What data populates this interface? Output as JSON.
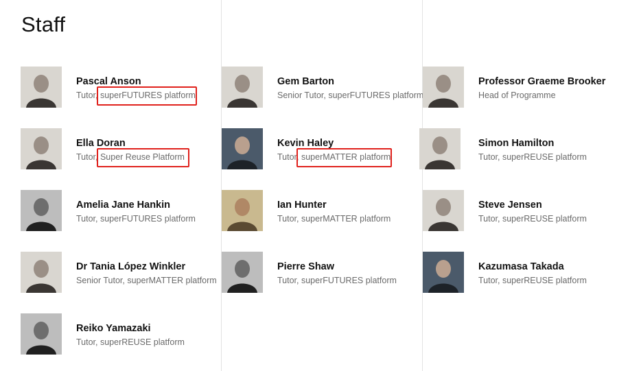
{
  "page": {
    "title": "Staff"
  },
  "staff": [
    {
      "name": "Pascal Anson",
      "role": "Tutor, superFUTURES platform",
      "photo_style": "light"
    },
    {
      "name": "Gem Barton",
      "role": "Senior Tutor, superFUTURES platform",
      "photo_style": "light"
    },
    {
      "name": "Professor Graeme Brooker",
      "role": "Head of Programme",
      "photo_style": "light"
    },
    {
      "name": "Ella Doran",
      "role": "Tutor, Super Reuse Platform",
      "photo_style": "light"
    },
    {
      "name": "Kevin Haley",
      "role": "Tutor, superMATTER platform",
      "photo_style": "dark"
    },
    {
      "name": "Simon Hamilton",
      "role": "Tutor, superREUSE platform",
      "photo_style": "light"
    },
    {
      "name": "Amelia Jane Hankin",
      "role": "Tutor, superFUTURES platform",
      "photo_style": "mono"
    },
    {
      "name": "Ian Hunter",
      "role": "Tutor, superMATTER platform",
      "photo_style": "warm"
    },
    {
      "name": "Steve Jensen",
      "role": "Tutor, superREUSE platform",
      "photo_style": "light"
    },
    {
      "name": "Dr Tania López Winkler",
      "role": "Senior Tutor, superMATTER platform",
      "photo_style": "light"
    },
    {
      "name": "Pierre Shaw",
      "role": "Tutor, superFUTURES platform",
      "photo_style": "mono"
    },
    {
      "name": "Kazumasa Takada",
      "role": "Tutor, superREUSE platform",
      "photo_style": "dark"
    },
    {
      "name": "Reiko Yamazaki",
      "role": "Tutor, superREUSE platform",
      "photo_style": "mono"
    }
  ],
  "annotations": {
    "highlight_color": "#e0201b"
  }
}
